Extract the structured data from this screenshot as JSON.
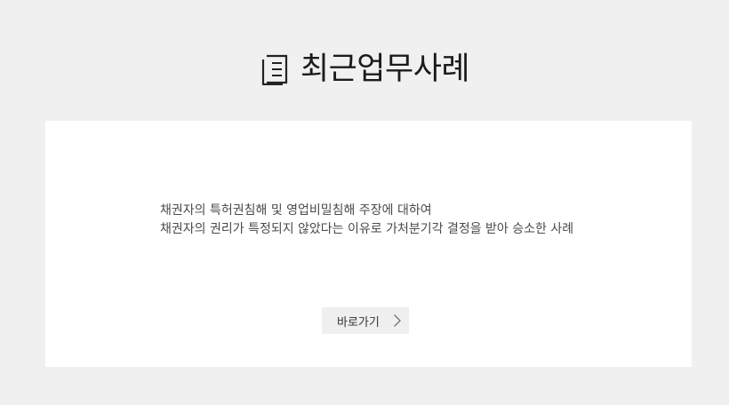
{
  "section": {
    "title": "최근업무사례",
    "icon": "document-list-icon"
  },
  "case": {
    "line1": "채권자의 특허권침해 및 영업비밀침해 주장에 대하여",
    "line2": "채권자의 권리가 특정되지 않았다는 이유로 가처분기각 결정을 받아 승소한 사례"
  },
  "button": {
    "label": "바로가기",
    "icon": "chevron-right-icon"
  },
  "colors": {
    "page_background": "#f0f0f0",
    "card_background": "#ffffff",
    "button_background": "#efefef",
    "title_text": "#1b1b1b",
    "body_text": "#4a4a4a"
  }
}
